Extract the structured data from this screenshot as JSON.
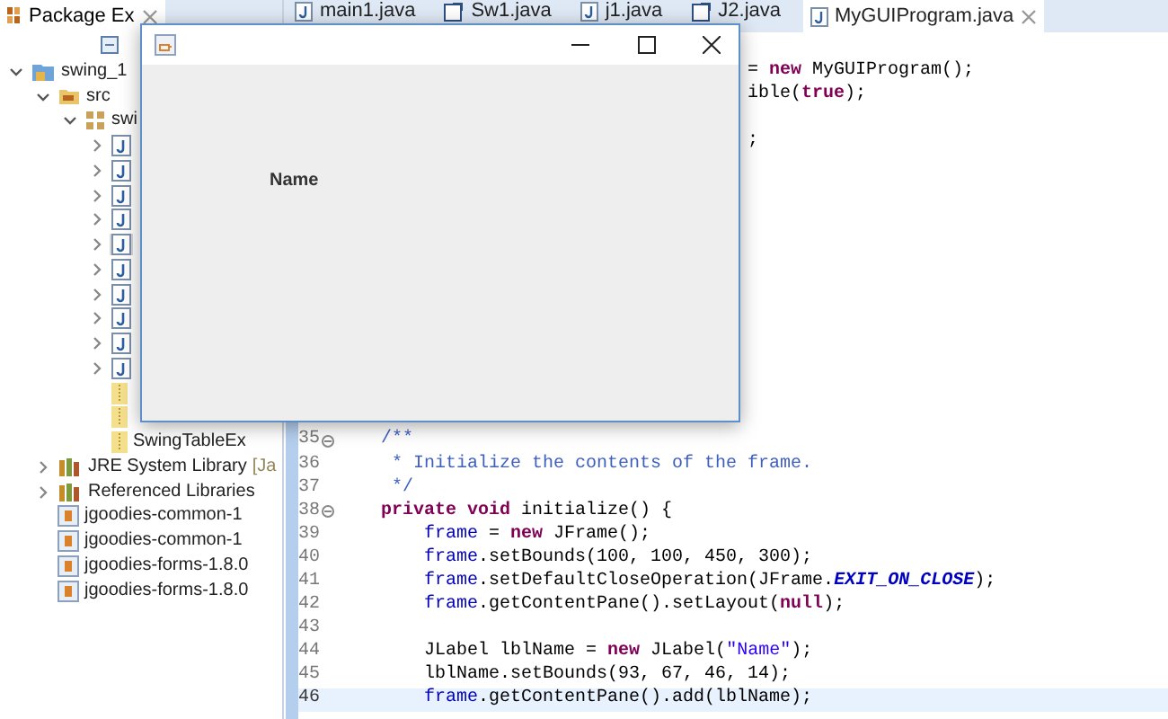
{
  "explorer": {
    "tab": {
      "label": "Package Ex",
      "selected": true
    },
    "tree": [
      {
        "kind": "project",
        "label": "swing_1",
        "expanded": true,
        "selected": false,
        "children": [
          {
            "kind": "folder",
            "label": "src",
            "expanded": true,
            "selected": false,
            "children": [
              {
                "kind": "package",
                "label": "swi",
                "expanded": true,
                "selected": false,
                "children": [
                  {
                    "kind": "java",
                    "expanded": false,
                    "selected": false
                  },
                  {
                    "kind": "java",
                    "expanded": false,
                    "selected": false
                  },
                  {
                    "kind": "java",
                    "expanded": false,
                    "selected": false
                  },
                  {
                    "kind": "java",
                    "expanded": false,
                    "selected": false
                  },
                  {
                    "kind": "java",
                    "expanded": false,
                    "selected": true
                  },
                  {
                    "kind": "java",
                    "expanded": false,
                    "selected": false
                  },
                  {
                    "kind": "java",
                    "expanded": false,
                    "selected": false
                  },
                  {
                    "kind": "java",
                    "expanded": false,
                    "selected": false
                  },
                  {
                    "kind": "java",
                    "expanded": false,
                    "selected": false
                  },
                  {
                    "kind": "java",
                    "expanded": false,
                    "selected": false
                  },
                  {
                    "kind": "archive",
                    "selected": false
                  },
                  {
                    "kind": "archive",
                    "selected": false
                  },
                  {
                    "kind": "archive",
                    "label": "SwingTableEx",
                    "selected": false
                  }
                ]
              }
            ]
          },
          {
            "kind": "library",
            "label": "JRE System Library",
            "decoration": "[Ja",
            "expanded": false,
            "selected": false
          },
          {
            "kind": "library",
            "label": "Referenced Libraries",
            "expanded": false,
            "selected": false
          },
          {
            "kind": "jar",
            "label": "jgoodies-common-1",
            "selected": false
          },
          {
            "kind": "jar",
            "label": "jgoodies-common-1",
            "selected": false
          },
          {
            "kind": "jar",
            "label": "jgoodies-forms-1.8.0",
            "selected": false
          },
          {
            "kind": "jar",
            "label": "jgoodies-forms-1.8.0",
            "selected": false
          }
        ]
      }
    ]
  },
  "editor": {
    "tabs": [
      {
        "label": "main1.java",
        "kind": "java",
        "selected": false
      },
      {
        "label": "Sw1.java",
        "kind": "main",
        "selected": false
      },
      {
        "label": "j1.java",
        "kind": "java",
        "selected": false
      },
      {
        "label": "J2.java",
        "kind": "main",
        "selected": false
      },
      {
        "label": "MyGUIProgram.java",
        "kind": "java",
        "selected": true
      }
    ],
    "fragments": [
      {
        "tokens": [
          {
            "kind": "plain",
            "text": "= "
          },
          {
            "kind": "keyword",
            "text": "new"
          },
          {
            "kind": "plain",
            "text": " MyGUIProgram();"
          }
        ]
      },
      {
        "tokens": [
          {
            "kind": "plain",
            "text": "ible("
          },
          {
            "kind": "keyword",
            "text": "true"
          },
          {
            "kind": "plain",
            "text": ");"
          }
        ]
      },
      {
        "tokens": [
          {
            "kind": "plain",
            "text": ";"
          }
        ]
      }
    ],
    "lines": [
      {
        "number": "35",
        "fold": true,
        "current": false,
        "tokens": [
          {
            "kind": "comment",
            "text": "    /**"
          }
        ]
      },
      {
        "number": "36",
        "fold": false,
        "current": false,
        "tokens": [
          {
            "kind": "comment",
            "text": "     * Initialize the contents of the frame."
          }
        ]
      },
      {
        "number": "37",
        "fold": false,
        "current": false,
        "tokens": [
          {
            "kind": "comment",
            "text": "     */"
          }
        ]
      },
      {
        "number": "38",
        "fold": true,
        "current": false,
        "tokens": [
          {
            "kind": "keyword",
            "text": "    private"
          },
          {
            "kind": "keyword",
            "text": " void"
          },
          {
            "kind": "plain",
            "text": " initialize() {"
          }
        ]
      },
      {
        "number": "39",
        "fold": false,
        "current": false,
        "tokens": [
          {
            "kind": "field",
            "text": "        frame"
          },
          {
            "kind": "plain",
            "text": " = "
          },
          {
            "kind": "keyword",
            "text": "new"
          },
          {
            "kind": "plain",
            "text": " JFrame();"
          }
        ]
      },
      {
        "number": "40",
        "fold": false,
        "current": false,
        "tokens": [
          {
            "kind": "field",
            "text": "        frame"
          },
          {
            "kind": "plain",
            "text": ".setBounds(100, 100, 450, 300);"
          }
        ]
      },
      {
        "number": "41",
        "fold": false,
        "current": false,
        "tokens": [
          {
            "kind": "field",
            "text": "        frame"
          },
          {
            "kind": "plain",
            "text": ".setDefaultCloseOperation(JFrame."
          },
          {
            "kind": "static",
            "text": "EXIT_ON_CLOSE"
          },
          {
            "kind": "plain",
            "text": ");"
          }
        ]
      },
      {
        "number": "42",
        "fold": false,
        "current": false,
        "tokens": [
          {
            "kind": "field",
            "text": "        frame"
          },
          {
            "kind": "plain",
            "text": ".getContentPane().setLayout("
          },
          {
            "kind": "keyword",
            "text": "null"
          },
          {
            "kind": "plain",
            "text": ");"
          }
        ]
      },
      {
        "number": "43",
        "fold": false,
        "current": false
      },
      {
        "number": "44",
        "fold": false,
        "current": false,
        "tokens": [
          {
            "kind": "plain",
            "text": "        JLabel lblName = "
          },
          {
            "kind": "keyword",
            "text": "new"
          },
          {
            "kind": "plain",
            "text": " JLabel("
          },
          {
            "kind": "string",
            "text": "\"Name\""
          },
          {
            "kind": "plain",
            "text": ");"
          }
        ]
      },
      {
        "number": "45",
        "fold": false,
        "current": false,
        "tokens": [
          {
            "kind": "plain",
            "text": "        lblName.setBounds(93, 67, 46, 14);"
          }
        ]
      },
      {
        "number": "46",
        "fold": false,
        "current": true,
        "tokens": [
          {
            "kind": "field",
            "text": "        frame"
          },
          {
            "kind": "plain",
            "text": ".getContentPane().add(lblName);"
          }
        ]
      }
    ]
  },
  "frame": {
    "label": "Name"
  }
}
